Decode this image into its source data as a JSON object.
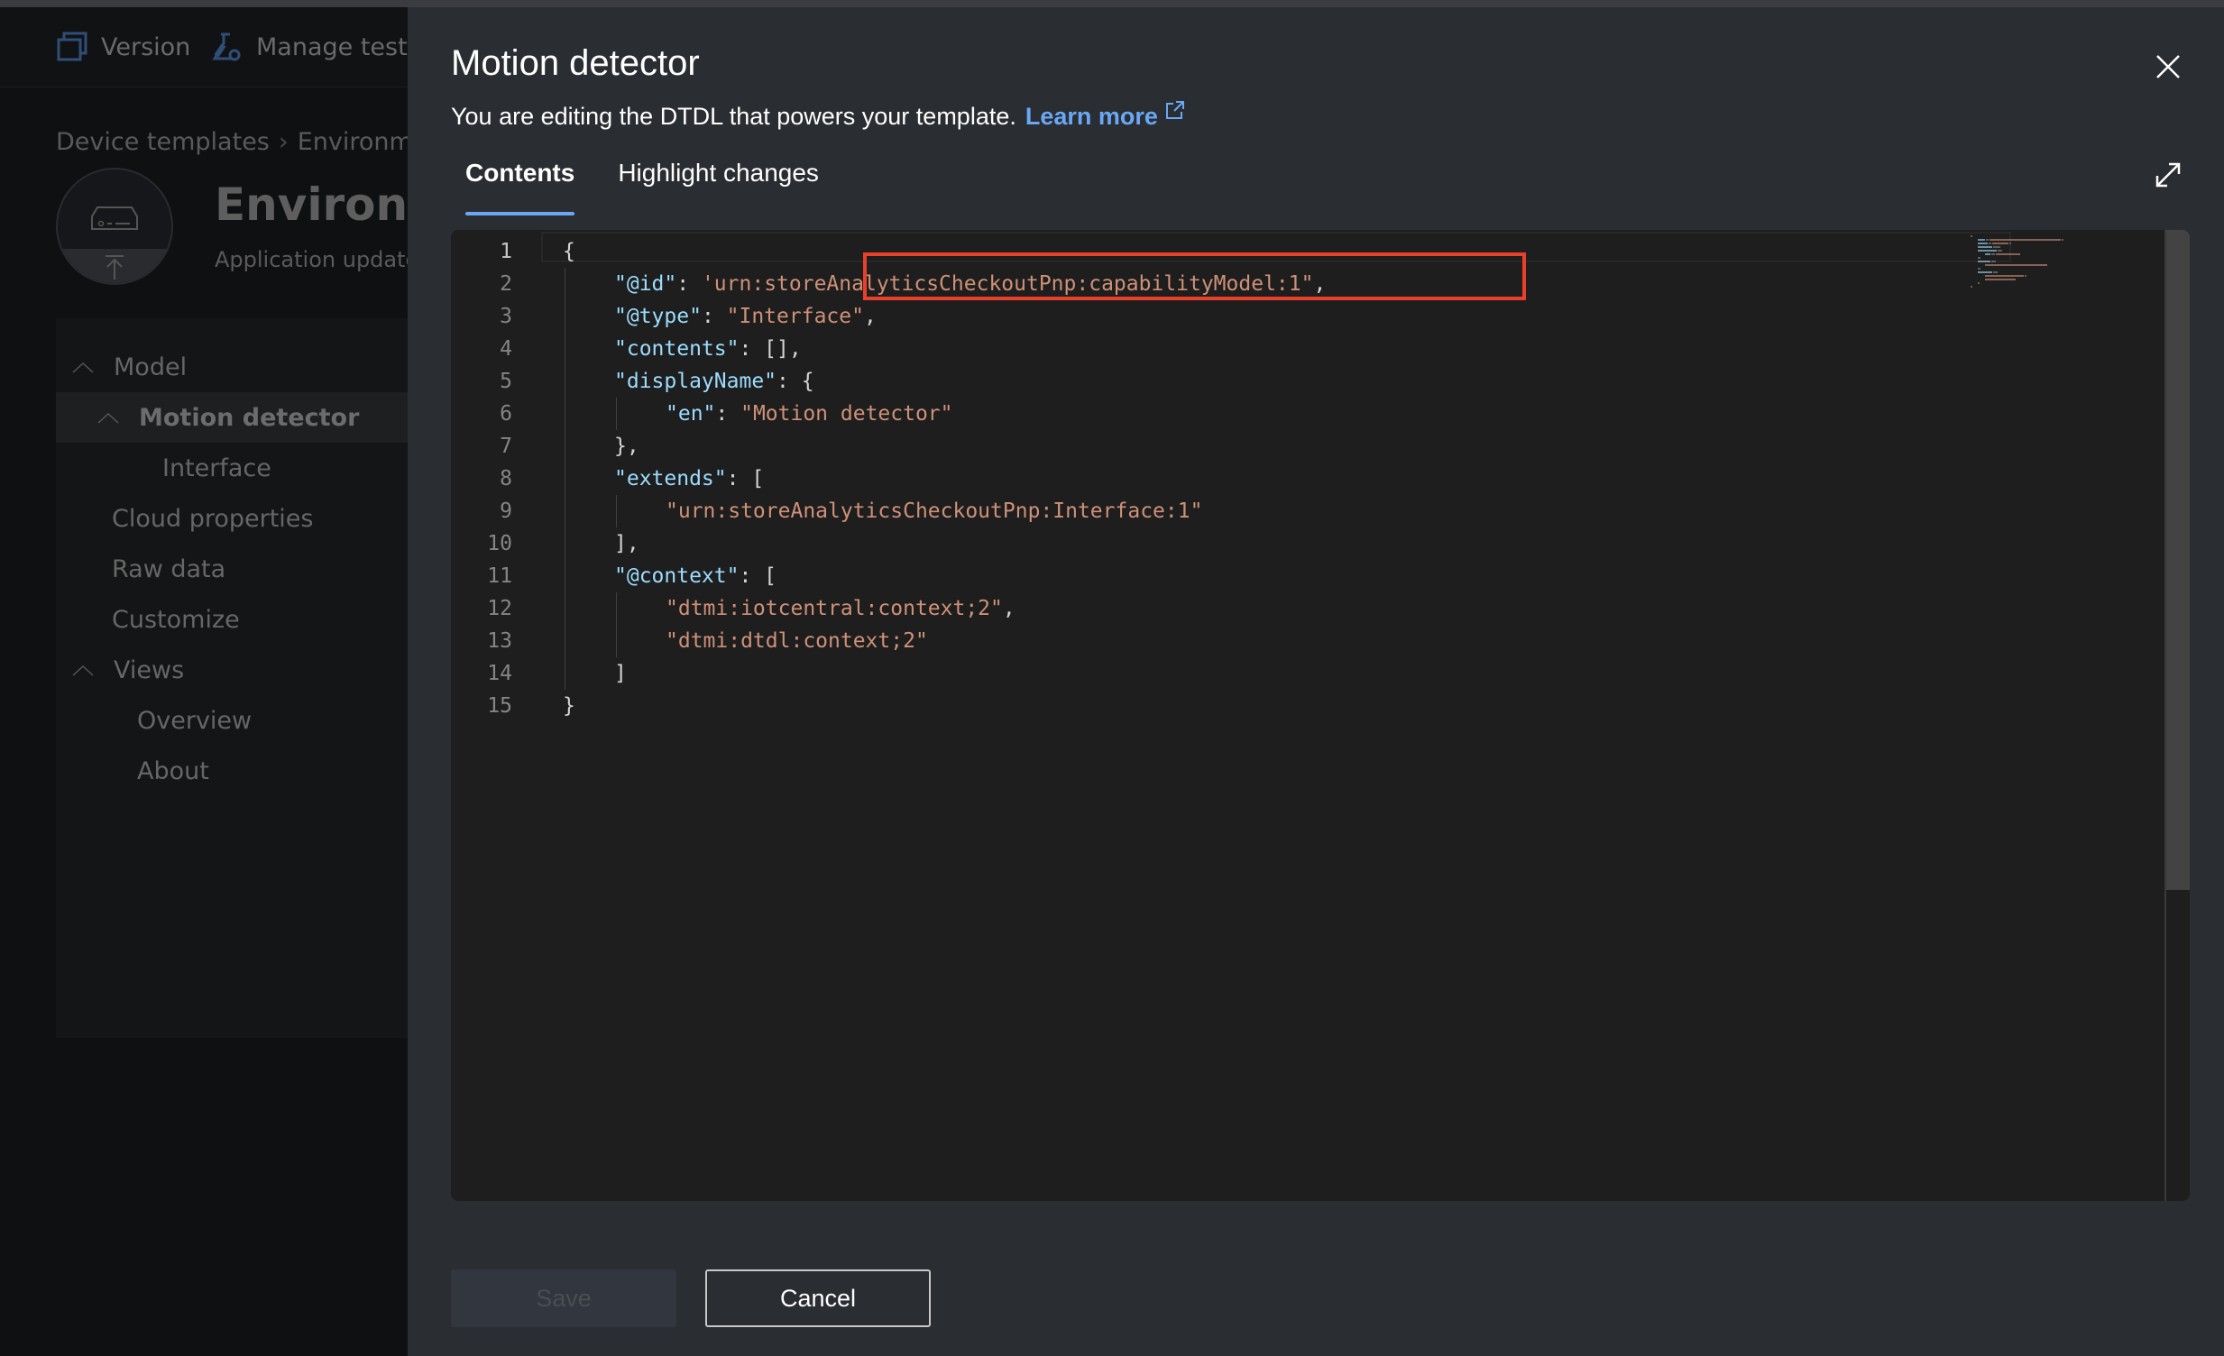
{
  "background_app": {
    "command_bar": [
      {
        "label": "Version",
        "icon": "version-icon"
      },
      {
        "label": "Manage test device",
        "icon": "flask-gear-icon"
      }
    ],
    "breadcrumb": [
      "Device templates",
      "Environment sensor"
    ],
    "template_title": "Environment sensor",
    "template_subtitle": "Application updated:",
    "nav": {
      "model": "Model",
      "motion_detector": "Motion detector",
      "interface": "Interface",
      "cloud_properties": "Cloud properties",
      "raw_data": "Raw data",
      "customize": "Customize",
      "views": "Views",
      "overview": "Overview",
      "about": "About"
    }
  },
  "panel": {
    "title": "Motion detector",
    "subtitle": "You are editing the DTDL that powers your template.",
    "learn_more": "Learn more",
    "tabs": [
      {
        "label": "Contents",
        "active": true
      },
      {
        "label": "Highlight changes",
        "active": false
      }
    ],
    "editor": {
      "line_numbers": [
        "1",
        "2",
        "3",
        "4",
        "5",
        "6",
        "7",
        "8",
        "9",
        "10",
        "11",
        "12",
        "13",
        "14",
        "15"
      ],
      "current_line": 1,
      "highlighted_value": "'urn:storeAnalyticsCheckoutPnp:capabilityModel:1\",",
      "scroll_fraction_visible": 0.68,
      "lines": [
        {
          "indent": 0,
          "tokens": [
            {
              "t": "p",
              "v": "{"
            }
          ]
        },
        {
          "indent": 1,
          "tokens": [
            {
              "t": "k",
              "v": "\"@id\""
            },
            {
              "t": "p",
              "v": ": "
            },
            {
              "t": "s",
              "v": "'urn:storeAnalyticsCheckoutPnp:capabilityModel:1\""
            },
            {
              "t": "p",
              "v": ","
            }
          ]
        },
        {
          "indent": 1,
          "tokens": [
            {
              "t": "k",
              "v": "\"@type\""
            },
            {
              "t": "p",
              "v": ": "
            },
            {
              "t": "s",
              "v": "\"Interface\""
            },
            {
              "t": "p",
              "v": ","
            }
          ]
        },
        {
          "indent": 1,
          "tokens": [
            {
              "t": "k",
              "v": "\"contents\""
            },
            {
              "t": "p",
              "v": ": [],"
            }
          ]
        },
        {
          "indent": 1,
          "tokens": [
            {
              "t": "k",
              "v": "\"displayName\""
            },
            {
              "t": "p",
              "v": ": {"
            }
          ]
        },
        {
          "indent": 2,
          "tokens": [
            {
              "t": "k",
              "v": "\"en\""
            },
            {
              "t": "p",
              "v": ": "
            },
            {
              "t": "s",
              "v": "\"Motion detector\""
            }
          ]
        },
        {
          "indent": 1,
          "tokens": [
            {
              "t": "p",
              "v": "},"
            }
          ]
        },
        {
          "indent": 1,
          "tokens": [
            {
              "t": "k",
              "v": "\"extends\""
            },
            {
              "t": "p",
              "v": ": ["
            }
          ]
        },
        {
          "indent": 2,
          "tokens": [
            {
              "t": "s",
              "v": "\"urn:storeAnalyticsCheckoutPnp:Interface:1\""
            }
          ]
        },
        {
          "indent": 1,
          "tokens": [
            {
              "t": "p",
              "v": "],"
            }
          ]
        },
        {
          "indent": 1,
          "tokens": [
            {
              "t": "k",
              "v": "\"@context\""
            },
            {
              "t": "p",
              "v": ": ["
            }
          ]
        },
        {
          "indent": 2,
          "tokens": [
            {
              "t": "s",
              "v": "\"dtmi:iotcentral:context;2\""
            },
            {
              "t": "p",
              "v": ","
            }
          ]
        },
        {
          "indent": 2,
          "tokens": [
            {
              "t": "s",
              "v": "\"dtmi:dtdl:context;2\""
            }
          ]
        },
        {
          "indent": 1,
          "tokens": [
            {
              "t": "p",
              "v": "]"
            }
          ]
        },
        {
          "indent": 0,
          "tokens": [
            {
              "t": "p",
              "v": "}"
            }
          ]
        }
      ]
    },
    "buttons": {
      "save": "Save",
      "save_disabled": true,
      "cancel": "Cancel"
    }
  },
  "colors": {
    "accent": "#6aa7f5",
    "json_key": "#9cdcfe",
    "json_string": "#ce9178",
    "annotation_box": "#e8402a"
  }
}
